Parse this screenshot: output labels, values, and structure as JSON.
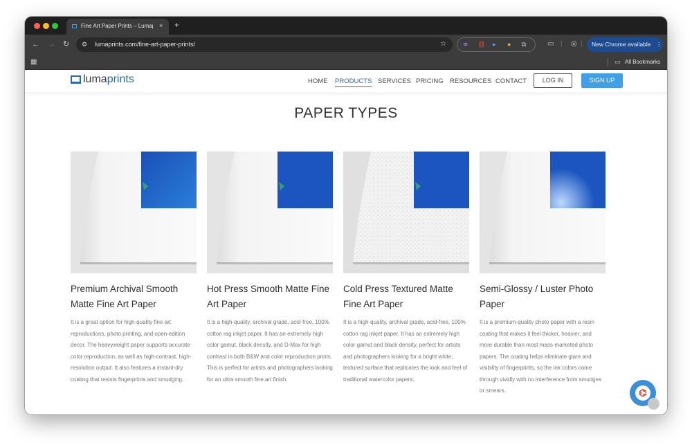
{
  "browser": {
    "tab_title": "Fine Art Paper Prints – Lumaprints",
    "tab_close": "×",
    "new_tab": "+",
    "url": "lumaprints.com/fine-art-paper-prints/",
    "update_label": "New Chrome available",
    "bookmarks_label": "All Bookmarks"
  },
  "site": {
    "logo_a": "luma",
    "logo_b": "prints",
    "nav": [
      "HOME",
      "PRODUCTS",
      "SERVICES",
      "PRICING",
      "RESOURCES",
      "CONTACT"
    ],
    "active_nav": "PRODUCTS",
    "login_label": "LOG IN",
    "signup_label": "SIGN UP",
    "brand_color": "#2a6bb0",
    "accent_color": "#3fa0e8"
  },
  "main": {
    "heading": "PAPER TYPES",
    "papers": [
      {
        "title": "Premium Archival Smooth Matte Fine Art Paper",
        "description": "It is a great option for high-quality fine art reproductions, photo printing, and open-edition decor. The heavyweight paper supports accurate color reproduction, as well as high-contrast, high-resolution output. It also features a instant-dry coating that resists fingerprints and smudging.",
        "texture": "smooth"
      },
      {
        "title": "Hot Press Smooth Matte Fine Art Paper",
        "description": "It is a high-quality, archival grade, acid-free, 100% cotton rag inkjet paper. It has an extremely high color gamut, black density, and D-Max for high contrast in both B&W and color reproduction prints. This is perfect for artists and photographers looking for an ultra smooth fine art finish.",
        "texture": "smooth"
      },
      {
        "title": "Cold Press Textured Matte Fine Art Paper",
        "description": "It is a high-quality, archival grade, acid-free, 100% cotton rag inkjet paper. It has an extremely high color gamut and black density, perfect for artists and photographers looking for a bright white, textured surface that replicates the look and feel of traditional watercolor papers.",
        "texture": "textured"
      },
      {
        "title": "Semi-Glossy / Luster Photo Paper",
        "description": "It is a premium-quality photo paper with a resin coating that makes it feel thicker, heavier, and more durable than most mass-marketed photo papers. The coating helps eliminate glare and visibility of fingerprints, so the ink colors come through vividly with no interference from smudges or smears.",
        "texture": "luster"
      }
    ]
  },
  "icons": {
    "pdf": "pdf-icon",
    "pdf_glyph": "♲"
  }
}
